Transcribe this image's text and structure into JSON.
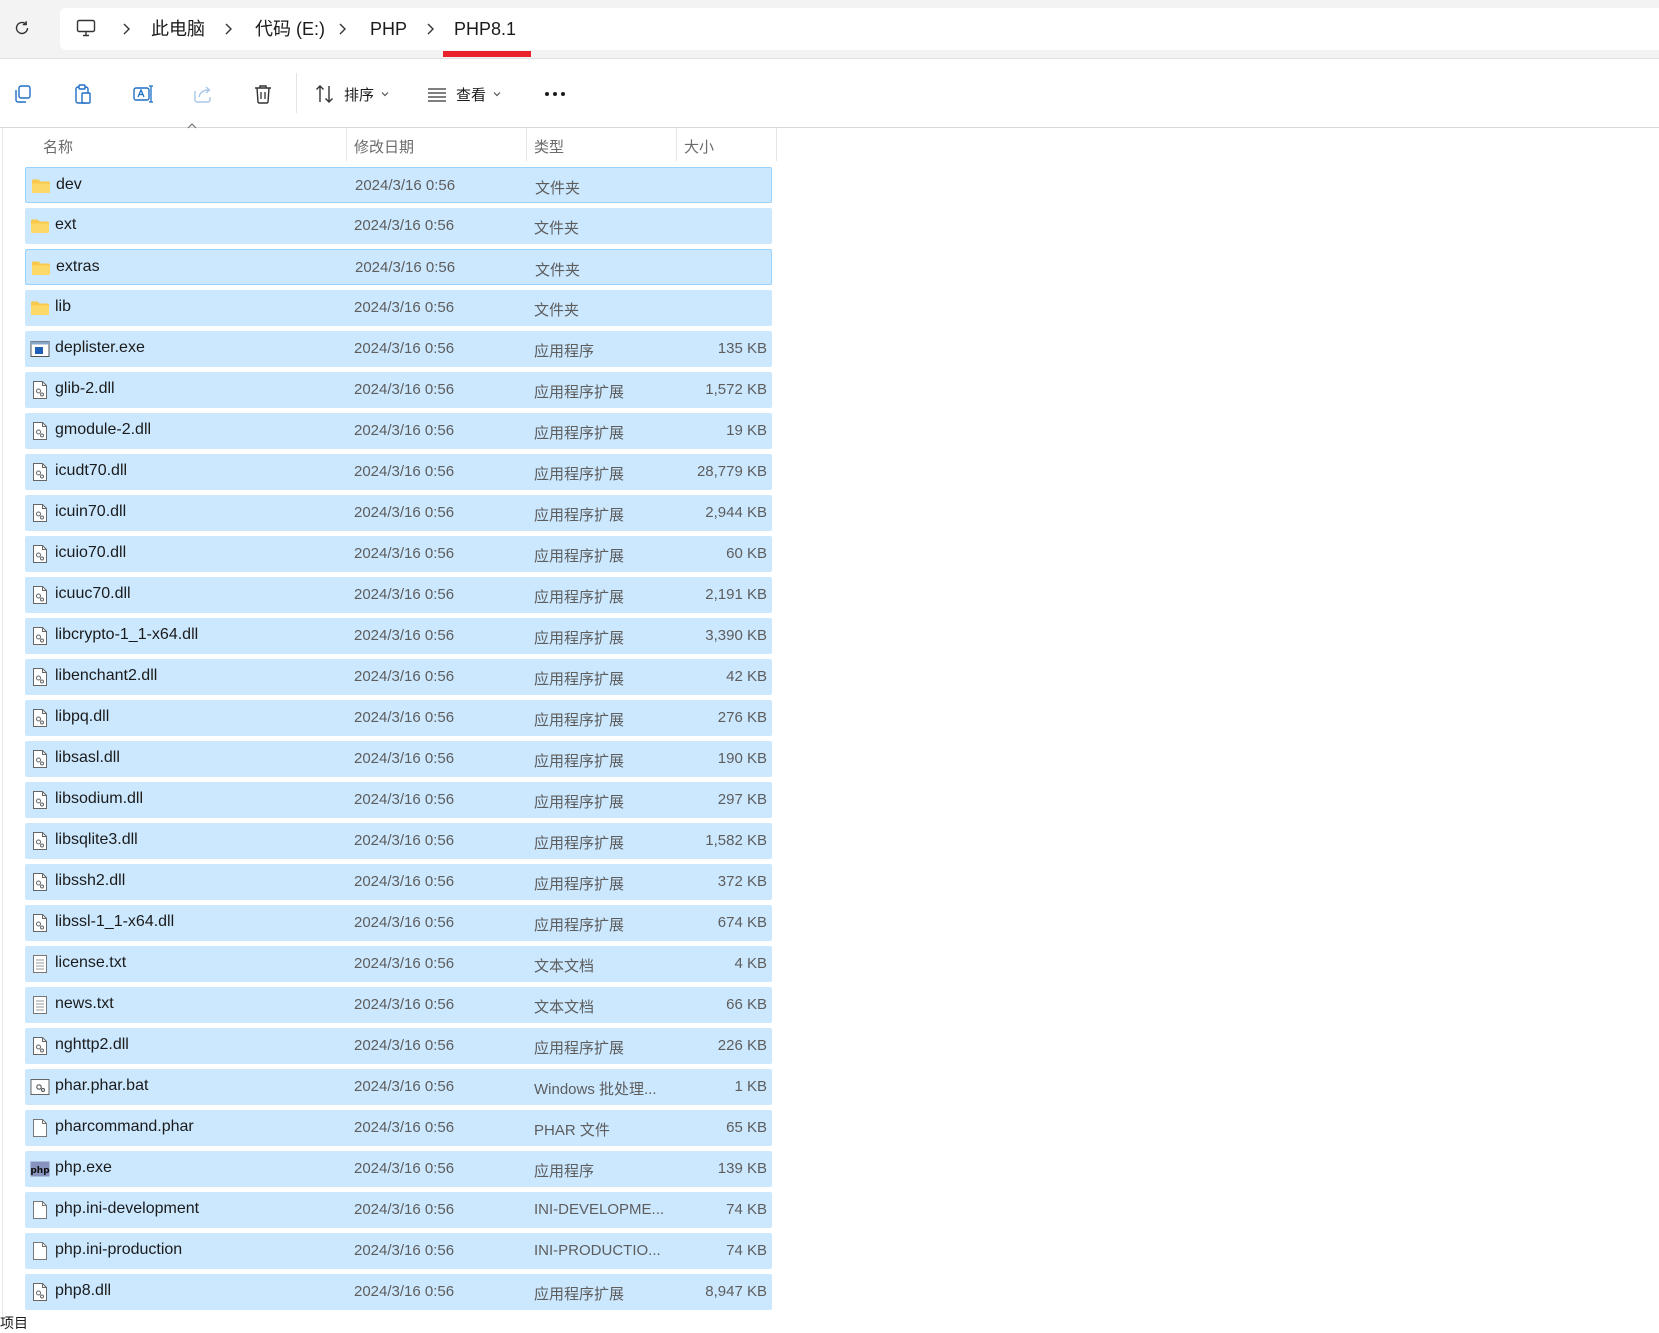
{
  "breadcrumb": {
    "items": [
      "此电脑",
      "代码 (E:)",
      "PHP",
      "PHP8.1"
    ]
  },
  "toolbar": {
    "sort_label": "排序",
    "view_label": "查看"
  },
  "columns": {
    "name": "名称",
    "date": "修改日期",
    "type": "类型",
    "size": "大小"
  },
  "files": [
    {
      "name": "dev",
      "date": "2024/3/16 0:56",
      "type": "文件夹",
      "size": "",
      "icon": "folder-icon"
    },
    {
      "name": "ext",
      "date": "2024/3/16 0:56",
      "type": "文件夹",
      "size": "",
      "icon": "folder-icon"
    },
    {
      "name": "extras",
      "date": "2024/3/16 0:56",
      "type": "文件夹",
      "size": "",
      "icon": "folder-icon"
    },
    {
      "name": "lib",
      "date": "2024/3/16 0:56",
      "type": "文件夹",
      "size": "",
      "icon": "folder-icon"
    },
    {
      "name": "deplister.exe",
      "date": "2024/3/16 0:56",
      "type": "应用程序",
      "size": "135 KB",
      "icon": "exe-icon"
    },
    {
      "name": "glib-2.dll",
      "date": "2024/3/16 0:56",
      "type": "应用程序扩展",
      "size": "1,572 KB",
      "icon": "dll-icon"
    },
    {
      "name": "gmodule-2.dll",
      "date": "2024/3/16 0:56",
      "type": "应用程序扩展",
      "size": "19 KB",
      "icon": "dll-icon"
    },
    {
      "name": "icudt70.dll",
      "date": "2024/3/16 0:56",
      "type": "应用程序扩展",
      "size": "28,779 KB",
      "icon": "dll-icon"
    },
    {
      "name": "icuin70.dll",
      "date": "2024/3/16 0:56",
      "type": "应用程序扩展",
      "size": "2,944 KB",
      "icon": "dll-icon"
    },
    {
      "name": "icuio70.dll",
      "date": "2024/3/16 0:56",
      "type": "应用程序扩展",
      "size": "60 KB",
      "icon": "dll-icon"
    },
    {
      "name": "icuuc70.dll",
      "date": "2024/3/16 0:56",
      "type": "应用程序扩展",
      "size": "2,191 KB",
      "icon": "dll-icon"
    },
    {
      "name": "libcrypto-1_1-x64.dll",
      "date": "2024/3/16 0:56",
      "type": "应用程序扩展",
      "size": "3,390 KB",
      "icon": "dll-icon"
    },
    {
      "name": "libenchant2.dll",
      "date": "2024/3/16 0:56",
      "type": "应用程序扩展",
      "size": "42 KB",
      "icon": "dll-icon"
    },
    {
      "name": "libpq.dll",
      "date": "2024/3/16 0:56",
      "type": "应用程序扩展",
      "size": "276 KB",
      "icon": "dll-icon"
    },
    {
      "name": "libsasl.dll",
      "date": "2024/3/16 0:56",
      "type": "应用程序扩展",
      "size": "190 KB",
      "icon": "dll-icon"
    },
    {
      "name": "libsodium.dll",
      "date": "2024/3/16 0:56",
      "type": "应用程序扩展",
      "size": "297 KB",
      "icon": "dll-icon"
    },
    {
      "name": "libsqlite3.dll",
      "date": "2024/3/16 0:56",
      "type": "应用程序扩展",
      "size": "1,582 KB",
      "icon": "dll-icon"
    },
    {
      "name": "libssh2.dll",
      "date": "2024/3/16 0:56",
      "type": "应用程序扩展",
      "size": "372 KB",
      "icon": "dll-icon"
    },
    {
      "name": "libssl-1_1-x64.dll",
      "date": "2024/3/16 0:56",
      "type": "应用程序扩展",
      "size": "674 KB",
      "icon": "dll-icon"
    },
    {
      "name": "license.txt",
      "date": "2024/3/16 0:56",
      "type": "文本文档",
      "size": "4 KB",
      "icon": "text-file-icon"
    },
    {
      "name": "news.txt",
      "date": "2024/3/16 0:56",
      "type": "文本文档",
      "size": "66 KB",
      "icon": "text-file-icon"
    },
    {
      "name": "nghttp2.dll",
      "date": "2024/3/16 0:56",
      "type": "应用程序扩展",
      "size": "226 KB",
      "icon": "dll-icon"
    },
    {
      "name": "phar.phar.bat",
      "date": "2024/3/16 0:56",
      "type": "Windows 批处理...",
      "size": "1 KB",
      "icon": "batch-file-icon"
    },
    {
      "name": "pharcommand.phar",
      "date": "2024/3/16 0:56",
      "type": "PHAR 文件",
      "size": "65 KB",
      "icon": "blank-file-icon"
    },
    {
      "name": "php.exe",
      "date": "2024/3/16 0:56",
      "type": "应用程序",
      "size": "139 KB",
      "icon": "php-exe-icon"
    },
    {
      "name": "php.ini-development",
      "date": "2024/3/16 0:56",
      "type": "INI-DEVELOPME...",
      "size": "74 KB",
      "icon": "blank-file-icon"
    },
    {
      "name": "php.ini-production",
      "date": "2024/3/16 0:56",
      "type": "INI-PRODUCTIO...",
      "size": "74 KB",
      "icon": "blank-file-icon"
    },
    {
      "name": "php8.dll",
      "date": "2024/3/16 0:56",
      "type": "应用程序扩展",
      "size": "8,947 KB",
      "icon": "dll-icon"
    }
  ],
  "status": {
    "text": "项目"
  },
  "colors": {
    "selection": "#cce8ff",
    "selection_border": "#99d1ff",
    "accent_underline": "#e8212b",
    "folder": "#f8c94a"
  }
}
